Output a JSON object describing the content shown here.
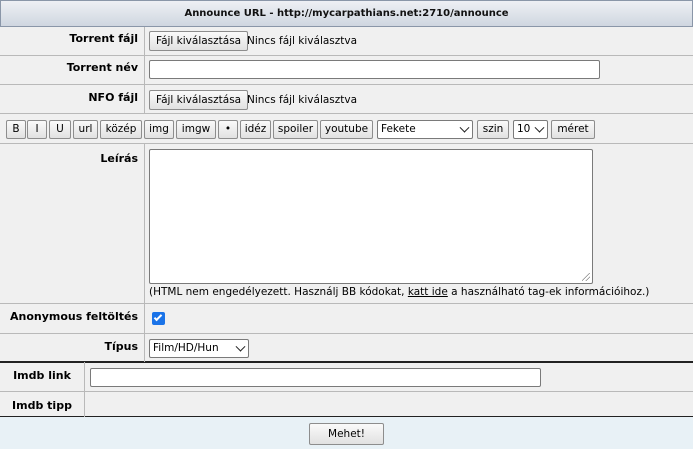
{
  "header": {
    "title": "Announce URL - http://mycarpathians.net:2710/announce"
  },
  "torrent_file": {
    "label": "Torrent fájl",
    "button": "Fájl kiválasztása",
    "status": "Nincs fájl kiválasztva"
  },
  "torrent_name": {
    "label": "Torrent név",
    "value": ""
  },
  "nfo_file": {
    "label": "NFO fájl",
    "button": "Fájl kiválasztása",
    "status": "Nincs fájl kiválasztva"
  },
  "bbcode": {
    "buttons": [
      "B",
      "I",
      "U",
      "url",
      "közép",
      "img",
      "imgw",
      "•",
      "idéz",
      "spoiler",
      "youtube"
    ],
    "color_select": "Fekete",
    "color_button": "szin",
    "size_select": "10",
    "size_button": "méret"
  },
  "description": {
    "label": "Leírás",
    "value": "",
    "hint_before": "(HTML nem engedélyezett. Használj BB kódokat,",
    "hint_link": "katt ide",
    "hint_after": "a használható tag-ek információihoz.)"
  },
  "anonymous": {
    "label": "Anonymous feltöltés",
    "checked": true
  },
  "type": {
    "label": "Típus",
    "selected": "Film/HD/Hun"
  },
  "imdb_link": {
    "label": "Imdb link",
    "value": ""
  },
  "imdb_tip": {
    "label": "Imdb tipp"
  },
  "submit": {
    "label": "Mehet!"
  },
  "colors": {
    "header_bg": "#cfd6e0",
    "checkbox": "#1a73e8",
    "footer_bg": "#e8f1f6",
    "row_bg": "#f0f0f0"
  },
  "icons": {
    "checkbox": "check-icon",
    "select": "chevron-down-icon",
    "textarea": "resize-grip-icon"
  }
}
